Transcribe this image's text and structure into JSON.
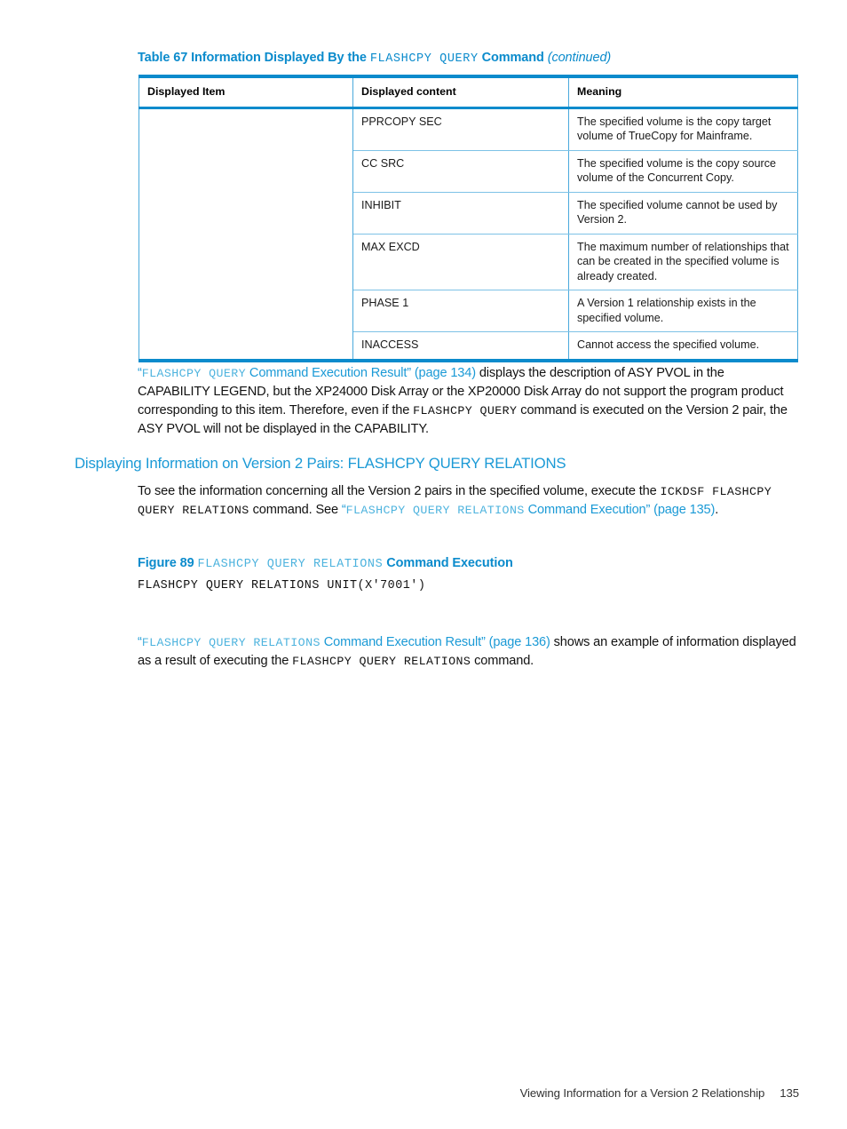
{
  "table": {
    "caption": {
      "prefix": "Table 67 Information Displayed By the ",
      "mono": "FLASHCPY  QUERY",
      "suffix": " Command ",
      "continued": "(continued)"
    },
    "headers": [
      "Displayed Item",
      "Displayed content",
      "Meaning"
    ],
    "first_column_value": "",
    "rows": [
      {
        "content": "PPRCOPY SEC",
        "meaning": "The specified volume is the copy target volume of TrueCopy for Mainframe."
      },
      {
        "content": "CC SRC",
        "meaning": "The specified volume is the copy source volume of the Concurrent Copy."
      },
      {
        "content": "INHIBIT",
        "meaning": "The specified volume cannot be used by Version 2."
      },
      {
        "content": "MAX EXCD",
        "meaning": "The maximum number of relationships that can be created in the specified volume is already created."
      },
      {
        "content": "PHASE 1",
        "meaning": "A Version 1 relationship exists in the specified volume."
      },
      {
        "content": "INACCESS",
        "meaning": "Cannot access the specified volume."
      }
    ]
  },
  "para_asy": {
    "link_quote_open": "“",
    "link_mono": "FLASHCPY  QUERY",
    "link_text": " Command Execution Result” (page 134)",
    "body": " displays the description of ASY PVOL in the CAPABILITY LEGEND, but the XP24000 Disk Array or the XP20000 Disk Array do not support the program product corresponding to this item. Therefore, even if the ",
    "mono_inline": "FLASHCPY  QUERY",
    "body_end": " command is executed on the Version 2 pair, the ASY PVOL will not be displayed in the CAPABILITY."
  },
  "section_heading": "Displaying Information on Version 2 Pairs: FLASHCPY QUERY RELATIONS",
  "para_intro": {
    "body_start": "To see the information concerning all the Version 2 pairs in the specified volume, execute the ",
    "mono_command": "ICKDSF FLASHCPY QUERY RELATIONS",
    "body_mid": " command. See ",
    "link_quote_open": "“",
    "link_mono": "FLASHCPY QUERY RELATIONS",
    "link_text": " Command Execution” (page 135)",
    "body_end": "."
  },
  "figure": {
    "caption_prefix": "Figure 89 ",
    "caption_mono": "FLASHCPY  QUERY  RELATIONS",
    "caption_suffix": " Command Execution",
    "code": "FLASHCPY QUERY RELATIONS UNIT(X'7001')"
  },
  "para_result": {
    "link_quote_open": "“",
    "link_mono": "FLASHCPY  QUERY  RELATIONS",
    "link_text": " Command Execution Result” (page 136)",
    "body": " shows an example of information displayed as a result of executing the ",
    "mono_inline": "FLASHCPY  QUERY  RELATIONS",
    "body_end": " command."
  },
  "footer": {
    "text": "Viewing Information for a Version 2 Relationship",
    "page_number": "135"
  },
  "colors": {
    "accent_blue": "#0b8bcc",
    "link_blue": "#1b9ad6",
    "mono_link_blue": "#4db3de",
    "table_border": "#4aa9dc",
    "table_inner_border": "#7dc2e6",
    "body_text": "#111111"
  }
}
